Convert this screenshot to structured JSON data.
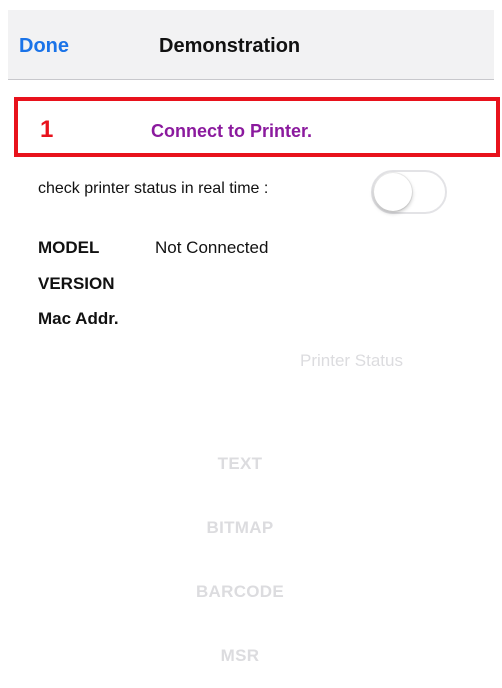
{
  "navbar": {
    "done_label": "Done",
    "title": "Demonstration"
  },
  "connect": {
    "step_number": "1",
    "button_label": "Connect to Printer."
  },
  "status": {
    "label": "check printer status in real time :",
    "toggle_on": false
  },
  "info": {
    "model_label": "MODEL",
    "model_value": "Not Connected",
    "version_label": "VERSION",
    "version_value": "",
    "mac_label": "Mac Addr.",
    "mac_value": ""
  },
  "printer_status_label": "Printer Status",
  "actions": {
    "text_label": "TEXT",
    "bitmap_label": "BITMAP",
    "barcode_label": "BARCODE",
    "msr_label": "MSR"
  },
  "colors": {
    "done": "#1a73e8",
    "highlight": "#e8121c",
    "connect": "#8b1a9e",
    "disabled": "#dcdcdf"
  }
}
